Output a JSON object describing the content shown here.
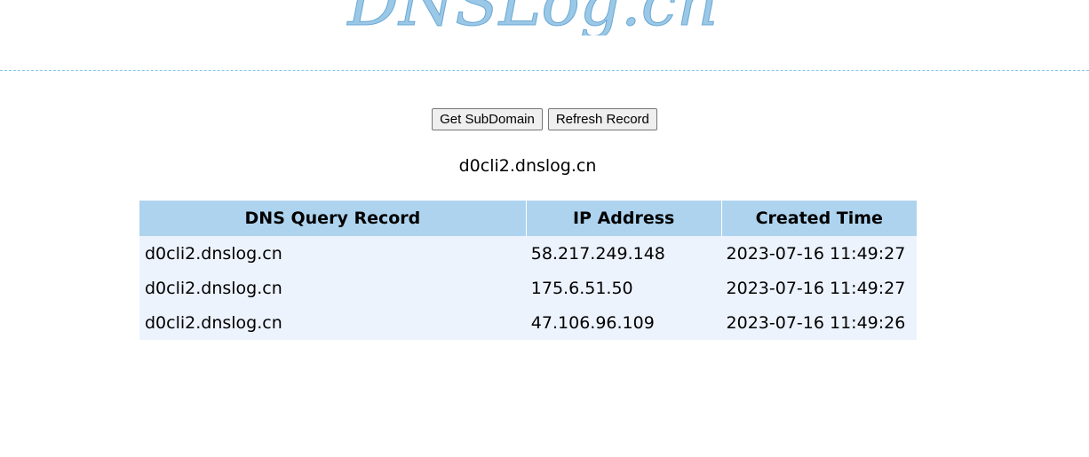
{
  "logo": {
    "text": "DNSLog.cn"
  },
  "colors": {
    "logo": "#9ac8e6",
    "divider": "#87c6e6",
    "table_header_bg": "#aed3ee",
    "table_row_bg": "#edf3fd"
  },
  "buttons": {
    "get_subdomain": "Get SubDomain",
    "refresh_record": "Refresh Record"
  },
  "subdomain": "d0cli2.dnslog.cn",
  "table": {
    "headers": [
      "DNS Query Record",
      "IP Address",
      "Created Time"
    ],
    "rows": [
      [
        "d0cli2.dnslog.cn",
        "58.217.249.148",
        "2023-07-16 11:49:27"
      ],
      [
        "d0cli2.dnslog.cn",
        "175.6.51.50",
        "2023-07-16 11:49:27"
      ],
      [
        "d0cli2.dnslog.cn",
        "47.106.96.109",
        "2023-07-16 11:49:26"
      ]
    ]
  }
}
